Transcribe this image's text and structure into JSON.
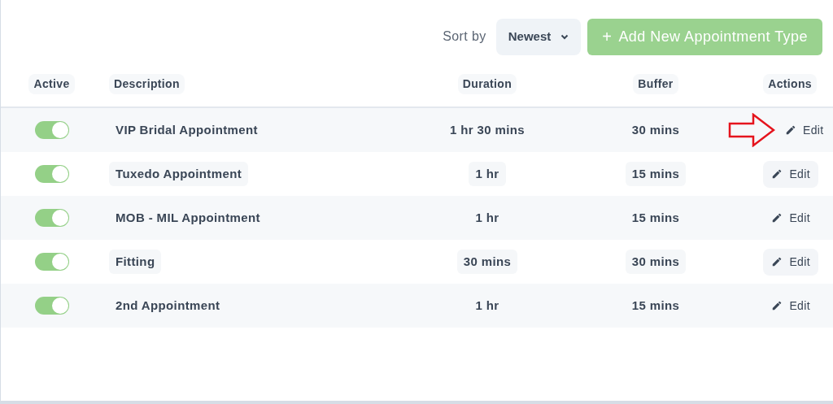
{
  "toolbar": {
    "sort_label": "Sort by",
    "sort_value": "Newest",
    "add_button": "Add New Appointment Type",
    "add_icon": "+"
  },
  "table": {
    "columns": [
      "Active",
      "Description",
      "Duration",
      "Buffer",
      "Actions"
    ],
    "rows": [
      {
        "active": true,
        "description": "VIP Bridal Appointment",
        "duration": "1 hr 30 mins",
        "buffer": "30 mins",
        "action": "Edit",
        "arrow": true
      },
      {
        "active": true,
        "description": "Tuxedo Appointment",
        "duration": "1 hr",
        "buffer": "15 mins",
        "action": "Edit",
        "arrow": false
      },
      {
        "active": true,
        "description": "MOB - MIL Appointment",
        "duration": "1 hr",
        "buffer": "15 mins",
        "action": "Edit",
        "arrow": false
      },
      {
        "active": true,
        "description": "Fitting",
        "duration": "30 mins",
        "buffer": "30 mins",
        "action": "Edit",
        "arrow": false
      },
      {
        "active": true,
        "description": "2nd Appointment",
        "duration": "1 hr",
        "buffer": "15 mins",
        "action": "Edit",
        "arrow": false
      }
    ]
  }
}
